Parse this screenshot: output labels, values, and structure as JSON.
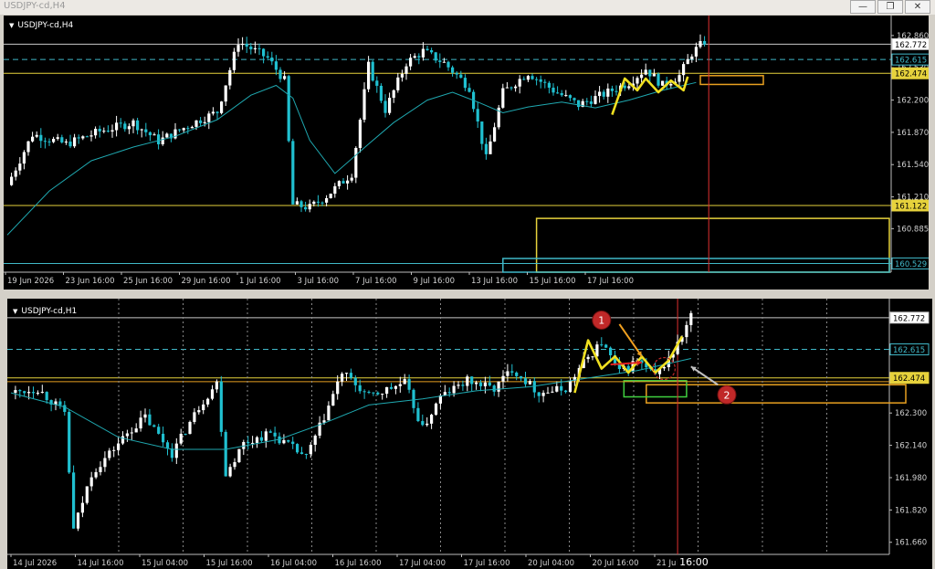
{
  "window": {
    "title": "USDJPY-cd,H4",
    "controls": [
      "minimize",
      "restore",
      "close"
    ]
  },
  "colors": {
    "background": "#000000",
    "bull": "#ffffff",
    "bear": "#20c0d0",
    "ma": "#1fa8b0",
    "level_yellow": "#e6d23c",
    "zone_orange": "#e8a020",
    "zone_green": "#40d040",
    "dashed_level": "#40b8c8",
    "vline": "#e03030"
  },
  "chart_data": [
    {
      "type": "candlestick",
      "symbol": "USDJPY-cd,H4",
      "timeframe": "H4",
      "x_ticks": [
        "19 Jun 2026",
        "23 Jun 16:00",
        "25 Jun 16:00",
        "29 Jun 16:00",
        "1 Jul 16:00",
        "3 Jul 16:00",
        "7 Jul 16:00",
        "9 Jul 16:00",
        "13 Jul 16:00",
        "15 Jul 16:00",
        "17 Jul 16:00"
      ],
      "y_ticks": [
        "162.860",
        "162.530",
        "162.200",
        "161.870",
        "161.540",
        "161.210",
        "160.885"
      ],
      "ylim": [
        160.44,
        162.99
      ],
      "price_labels": [
        "162.772",
        "162.615",
        "162.474",
        "161.122",
        "160.529"
      ],
      "levels": [
        {
          "price": 162.772,
          "style": "solid",
          "color": "#c8c8c8"
        },
        {
          "price": 162.615,
          "style": "dashed",
          "color": "#40b8c8"
        },
        {
          "price": 162.474,
          "style": "solid",
          "color": "#e6d23c"
        },
        {
          "price": 161.122,
          "style": "solid",
          "color": "#e6d23c"
        },
        {
          "price": 160.529,
          "style": "solid",
          "color": "#40b8c8"
        }
      ],
      "zones": [
        {
          "name": "orange-zone",
          "from_bar": 165,
          "to_bar": 180,
          "price_top": 162.45,
          "price_bottom": 162.36,
          "color": "#e8a020"
        },
        {
          "name": "yellow-box",
          "from_bar": 126,
          "to_bar": 210,
          "price_top": 160.99,
          "price_bottom": 160.44,
          "color": "#e6d23c"
        },
        {
          "name": "cyan-box",
          "from_bar": 118,
          "to_bar": 210,
          "price_top": 160.58,
          "price_bottom": 160.44,
          "color": "#40b8c8"
        }
      ],
      "vline_bar": 167,
      "bar_step": 4.6,
      "start_price": 161.33,
      "waypoints": [
        [
          0,
          161.33
        ],
        [
          6,
          161.85
        ],
        [
          14,
          161.75
        ],
        [
          22,
          161.88
        ],
        [
          30,
          161.97
        ],
        [
          36,
          161.78
        ],
        [
          44,
          161.96
        ],
        [
          50,
          162.08
        ],
        [
          55,
          162.8
        ],
        [
          62,
          162.63
        ],
        [
          66,
          162.4
        ],
        [
          68,
          161.13
        ],
        [
          72,
          161.1
        ],
        [
          76,
          161.22
        ],
        [
          82,
          161.45
        ],
        [
          86,
          162.55
        ],
        [
          90,
          162.1
        ],
        [
          95,
          162.58
        ],
        [
          99,
          162.7
        ],
        [
          104,
          162.58
        ],
        [
          110,
          162.33
        ],
        [
          114,
          161.6
        ],
        [
          118,
          162.28
        ],
        [
          124,
          162.48
        ],
        [
          130,
          162.3
        ],
        [
          136,
          162.15
        ],
        [
          142,
          162.26
        ],
        [
          148,
          162.38
        ],
        [
          152,
          162.52
        ],
        [
          156,
          162.35
        ],
        [
          160,
          162.45
        ],
        [
          163,
          162.68
        ],
        [
          166,
          162.8
        ]
      ],
      "ma_points": [
        [
          0,
          160.82
        ],
        [
          10,
          161.27
        ],
        [
          20,
          161.58
        ],
        [
          30,
          161.72
        ],
        [
          40,
          161.83
        ],
        [
          50,
          162.0
        ],
        [
          58,
          162.25
        ],
        [
          64,
          162.35
        ],
        [
          68,
          162.22
        ],
        [
          72,
          161.79
        ],
        [
          78,
          161.45
        ],
        [
          86,
          161.75
        ],
        [
          92,
          161.97
        ],
        [
          100,
          162.2
        ],
        [
          106,
          162.28
        ],
        [
          112,
          162.18
        ],
        [
          118,
          162.07
        ],
        [
          124,
          162.13
        ],
        [
          132,
          162.18
        ],
        [
          140,
          162.12
        ],
        [
          148,
          162.2
        ],
        [
          156,
          162.3
        ],
        [
          164,
          162.38
        ]
      ],
      "highlight_path": {
        "color": "#f0e020",
        "points": [
          [
            144,
            162.05
          ],
          [
            147,
            162.42
          ],
          [
            150,
            162.3
          ],
          [
            152,
            162.42
          ],
          [
            155,
            162.28
          ],
          [
            158,
            162.4
          ],
          [
            161,
            162.3
          ],
          [
            162,
            162.44
          ]
        ]
      }
    },
    {
      "type": "candlestick",
      "symbol": "USDJPY-cd,H1",
      "timeframe": "H1",
      "x_ticks": [
        "14 Jul 2026",
        "14 Jul 16:00",
        "15 Jul 04:00",
        "15 Jul 16:00",
        "16 Jul 04:00",
        "16 Jul 16:00",
        "17 Jul 04:00",
        "17 Jul 16:00",
        "20 Jul 04:00",
        "20 Jul 16:00",
        "21 Jul 04:00"
      ],
      "x_marker": "16:00",
      "y_ticks": [
        "162.772",
        "162.470",
        "162.300",
        "162.140",
        "161.980",
        "161.820",
        "161.660"
      ],
      "ylim": [
        161.6,
        162.83
      ],
      "price_labels": [
        "162.772",
        "162.615",
        "162.474"
      ],
      "levels": [
        {
          "price": 162.772,
          "style": "solid",
          "color": "#c8c8c8"
        },
        {
          "price": 162.615,
          "style": "dashed",
          "color": "#40b8c8"
        },
        {
          "price": 162.474,
          "style": "solid",
          "color": "#e6d23c"
        },
        {
          "price": 162.455,
          "style": "solid",
          "color": "#e8a020"
        }
      ],
      "zones": [
        {
          "name": "orange-zone",
          "from_bar": 142,
          "to_bar": 200,
          "price_top": 162.44,
          "price_bottom": 162.35,
          "color": "#e8a020"
        },
        {
          "name": "green-zone",
          "from_bar": 137,
          "to_bar": 151,
          "price_top": 162.46,
          "price_bottom": 162.38,
          "color": "#40d040"
        }
      ],
      "vline_bar": 149,
      "bar_step": 4.9,
      "start_price": 162.4,
      "waypoints": [
        [
          0,
          162.4
        ],
        [
          6,
          162.42
        ],
        [
          12,
          162.3
        ],
        [
          14,
          161.72
        ],
        [
          18,
          162.0
        ],
        [
          26,
          162.2
        ],
        [
          30,
          162.28
        ],
        [
          36,
          162.1
        ],
        [
          42,
          162.33
        ],
        [
          46,
          162.45
        ],
        [
          48,
          162.0
        ],
        [
          52,
          162.15
        ],
        [
          58,
          162.2
        ],
        [
          66,
          162.08
        ],
        [
          70,
          162.28
        ],
        [
          74,
          162.5
        ],
        [
          80,
          162.38
        ],
        [
          88,
          162.45
        ],
        [
          92,
          162.22
        ],
        [
          96,
          162.38
        ],
        [
          102,
          162.46
        ],
        [
          108,
          162.42
        ],
        [
          112,
          162.52
        ],
        [
          118,
          162.4
        ],
        [
          124,
          162.42
        ],
        [
          128,
          162.55
        ],
        [
          132,
          162.65
        ],
        [
          136,
          162.5
        ],
        [
          140,
          162.56
        ],
        [
          144,
          162.48
        ],
        [
          148,
          162.6
        ],
        [
          150,
          162.68
        ],
        [
          152,
          162.78
        ]
      ],
      "ma_points": [
        [
          0,
          162.4
        ],
        [
          12,
          162.33
        ],
        [
          24,
          162.18
        ],
        [
          36,
          162.12
        ],
        [
          48,
          162.12
        ],
        [
          60,
          162.17
        ],
        [
          70,
          162.25
        ],
        [
          80,
          162.34
        ],
        [
          92,
          162.37
        ],
        [
          104,
          162.41
        ],
        [
          116,
          162.43
        ],
        [
          128,
          162.47
        ],
        [
          140,
          162.51
        ],
        [
          152,
          162.57
        ]
      ],
      "highlight_path": {
        "color": "#f0e020",
        "points": [
          [
            126,
            162.4
          ],
          [
            129,
            162.66
          ],
          [
            132,
            162.52
          ],
          [
            135,
            162.58
          ],
          [
            138,
            162.5
          ],
          [
            141,
            162.58
          ],
          [
            144,
            162.5
          ],
          [
            147,
            162.56
          ],
          [
            150,
            162.68
          ]
        ]
      },
      "annotations": [
        {
          "label": "1",
          "kind": "numbered-circle",
          "color": "#c02828",
          "bar": 132,
          "price": 162.76
        },
        {
          "label": "2",
          "kind": "numbered-circle",
          "color": "#c02828",
          "bar": 160,
          "price": 162.39
        },
        {
          "kind": "arrow",
          "color": "#f0a020",
          "from_bar": 136,
          "from_price": 162.74,
          "to_bar": 141,
          "to_price": 162.58
        },
        {
          "kind": "arrow",
          "color": "#e02020",
          "from_bar": 134,
          "from_price": 162.54,
          "to_bar": 141,
          "to_price": 162.55
        },
        {
          "kind": "arrow",
          "color": "#c0c0c0",
          "from_bar": 158,
          "from_price": 162.44,
          "to_bar": 152,
          "to_price": 162.53
        },
        {
          "kind": "dashed-circle",
          "color": "#c02828",
          "bar": 146,
          "price": 162.52
        }
      ]
    }
  ]
}
